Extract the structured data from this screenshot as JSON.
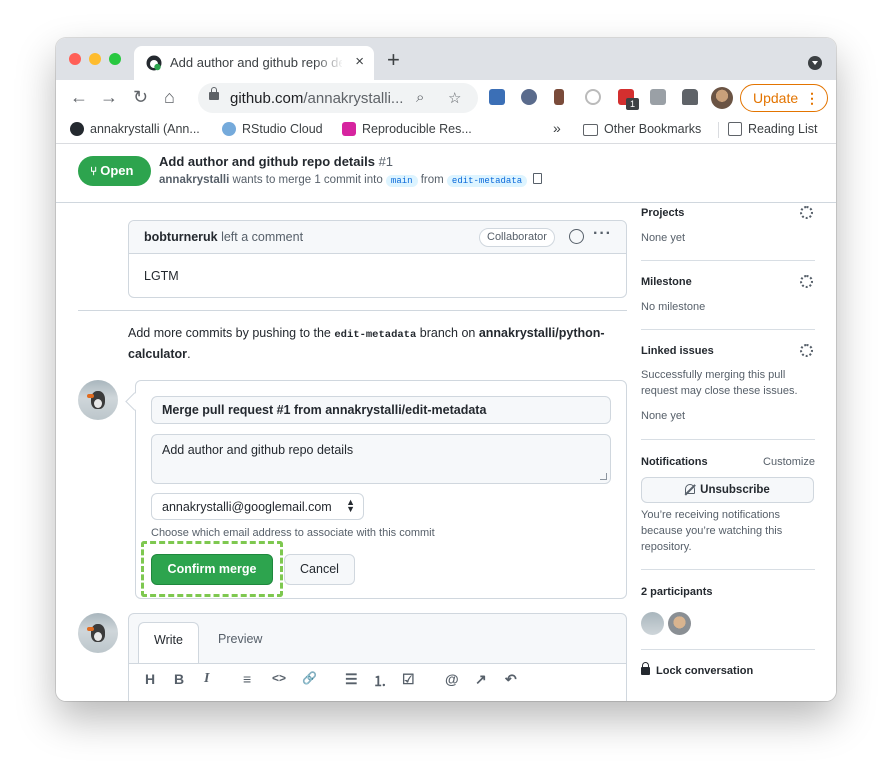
{
  "browser": {
    "tab_title": "Add author and github repo details",
    "tab_close": "×",
    "new_tab": "+",
    "url_host": "github.com",
    "url_rest": "/annakrystalli...",
    "update_label": "Update",
    "update_dots": "⋮",
    "ext_badge": "1",
    "bookmarks": [
      {
        "label": "annakrystalli (Ann..."
      },
      {
        "label": "RStudio Cloud"
      },
      {
        "label": "Reproducible Res..."
      }
    ],
    "more_bookmarks": "»",
    "other_bookmarks": "Other Bookmarks",
    "reading_list": "Reading List"
  },
  "pr": {
    "status": "Open",
    "title": "Add author and github repo details",
    "number": "#1",
    "author": "annakrystalli",
    "sub_mid": " wants to merge 1 commit into ",
    "base_branch": "main",
    "sub_from": " from ",
    "head_branch": "edit-metadata"
  },
  "comment": {
    "author": "bobturneruk",
    "action": " left a comment",
    "badge": "Collaborator",
    "more": "···",
    "body": "LGTM"
  },
  "add_commits": {
    "pre": "Add more commits by pushing to the ",
    "branch": "edit-metadata",
    "mid": " branch on ",
    "repo": "annakrystalli/python-calculator",
    "end": "."
  },
  "merge": {
    "title_value": "Merge pull request #1 from annakrystalli/edit-metadata",
    "description_value": "Add author and github repo details",
    "email_value": "annakrystalli@googlemail.com",
    "email_help": "Choose which email address to associate with this commit",
    "confirm_label": "Confirm merge",
    "cancel_label": "Cancel"
  },
  "editor": {
    "write_tab": "Write",
    "preview_tab": "Preview",
    "toolbar_icons": [
      "H",
      "B",
      "I",
      "≡",
      "<>",
      "🔗",
      "☰",
      "⒈",
      "☑",
      "@",
      "↗",
      "↶"
    ]
  },
  "sidebar": {
    "projects_head": "Projects",
    "projects_value": "None yet",
    "milestone_head": "Milestone",
    "milestone_value": "No milestone",
    "linked_head": "Linked issues",
    "linked_text": "Successfully merging this pull request may close these issues.",
    "linked_value": "None yet",
    "notifications_head": "Notifications",
    "customize": "Customize",
    "unsubscribe": "Unsubscribe",
    "notifications_text": "You’re receiving notifications because you’re watching this repository.",
    "participants_head": "2 participants",
    "lock_label": "Lock conversation"
  },
  "colors": {
    "accent_green": "#2da44e",
    "highlight": "#7ec850",
    "update_orange": "#e37400"
  }
}
